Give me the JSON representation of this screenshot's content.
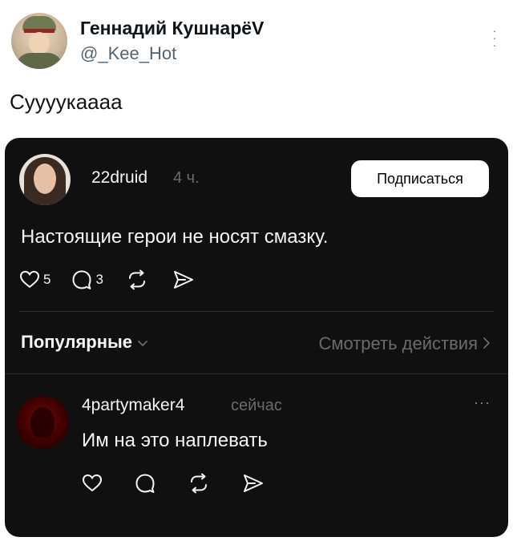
{
  "tweet": {
    "display_name": "Геннадий КушнарёV",
    "handle": "@_Kee_Hot",
    "text": "Суууукаааа",
    "more_icon": "more-vertical-icon",
    "avatar_icon": "avatar"
  },
  "embedded_post": {
    "username": "22druid",
    "time": "4 ч.",
    "subscribe_label": "Подписаться",
    "text": "Настоящие герои не носят смазку.",
    "likes": "5",
    "comments": "3",
    "icons": [
      "heart-icon",
      "comment-icon",
      "repost-icon",
      "share-icon"
    ]
  },
  "replies_header": {
    "sort_label": "Популярные",
    "view_activity_label": "Смотреть действия"
  },
  "reply": {
    "username": "4partymaker4",
    "time": "сейчас",
    "text": "Им на это наплевать",
    "more_label": "···"
  },
  "colors": {
    "embed_background": "#101010",
    "text_primary_dark": "#f3f5f7",
    "text_muted_dark": "#6b6b6b",
    "tweet_text": "#0f1419",
    "handle_gray": "#536471"
  }
}
